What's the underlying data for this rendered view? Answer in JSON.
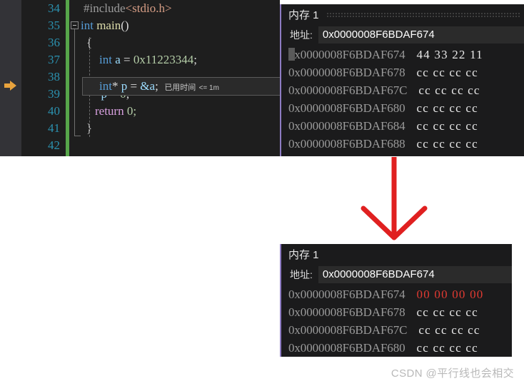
{
  "editor": {
    "line_numbers": [
      "34",
      "35",
      "36",
      "37",
      "38",
      "39",
      "40",
      "41",
      "42"
    ],
    "lines": [
      {
        "num": "34",
        "text": "#include<stdio.h>"
      },
      {
        "num": "35",
        "text": "int main()"
      },
      {
        "num": "36",
        "text": "{"
      },
      {
        "num": "37",
        "text": "    int a = 0x11223344;"
      },
      {
        "num": "38",
        "text": "    int* p = &a;"
      },
      {
        "num": "39",
        "text": "    *p = 0;"
      },
      {
        "num": "40",
        "text": "    return 0;"
      },
      {
        "num": "41",
        "text": "}"
      },
      {
        "num": "42",
        "text": ""
      }
    ],
    "tokens": {
      "include_directive": "#include",
      "include_header": "<stdio.h>",
      "kw_int": "int",
      "fn_main": "main",
      "paren_empty": "()",
      "brace_open": "{",
      "brace_close": "}",
      "decl_a": "int a = 0x11223344;",
      "decl_p": "int* p = &a;",
      "assign_star_p": "*p = 0;",
      "kw_return": "return",
      "return_value": "0;",
      "var_a": "a",
      "var_p": "p",
      "hex_literal": "0x11223344",
      "zero_literal": "0",
      "ptr_star": "*",
      "amp_a": "&a"
    },
    "current_statement": "int* p = &a;",
    "elapsed_label": "已用时间",
    "elapsed_value": "<= 1m",
    "exec_marker": "execution-pointer-arrow"
  },
  "memory_top": {
    "title": "内存 1",
    "address_label": "地址:",
    "address_value": "0x0000008F6BDAF674",
    "rows": [
      {
        "address": "0x0000008F6BDAF674",
        "bytes": "44 33 22 11",
        "highlight": false
      },
      {
        "address": "0x0000008F6BDAF678",
        "bytes": "cc cc cc cc",
        "highlight": false
      },
      {
        "address": "0x0000008F6BDAF67C",
        "bytes": "cc cc cc cc",
        "highlight": false
      },
      {
        "address": "0x0000008F6BDAF680",
        "bytes": "cc cc cc cc",
        "highlight": false
      },
      {
        "address": "0x0000008F6BDAF684",
        "bytes": "cc cc cc cc",
        "highlight": false
      },
      {
        "address": "0x0000008F6BDAF688",
        "bytes": "cc cc cc cc",
        "highlight": false
      }
    ]
  },
  "memory_bottom": {
    "title": "内存 1",
    "address_label": "地址:",
    "address_value": "0x0000008F6BDAF674",
    "rows": [
      {
        "address": "0x0000008F6BDAF674",
        "bytes": "00 00 00 00",
        "highlight": true
      },
      {
        "address": "0x0000008F6BDAF678",
        "bytes": "cc cc cc cc",
        "highlight": false
      },
      {
        "address": "0x0000008F6BDAF67C",
        "bytes": "cc cc cc cc",
        "highlight": false
      },
      {
        "address": "0x0000008F6BDAF680",
        "bytes": "cc cc cc cc",
        "highlight": false
      }
    ]
  },
  "annotation": {
    "arrow": "down-arrow-icon",
    "arrow_color": "#e02020"
  },
  "watermark": {
    "text": "CSDN @平行线也会相交"
  },
  "colors": {
    "editor_bg": "#1e1e1e",
    "memory_bg": "#1b1b1c",
    "keyword": "#569cd6",
    "function": "#dcdcaa",
    "number": "#b5cea8",
    "control": "#d8a0df",
    "variable": "#9cdcfe",
    "include_path": "#d69d85",
    "linenum": "#2b91af",
    "change_bar": "#57a64a",
    "panel_accent": "#8e7cc3",
    "byte_highlight": "#e03a32",
    "exec_arrow": "#e8a33d"
  }
}
